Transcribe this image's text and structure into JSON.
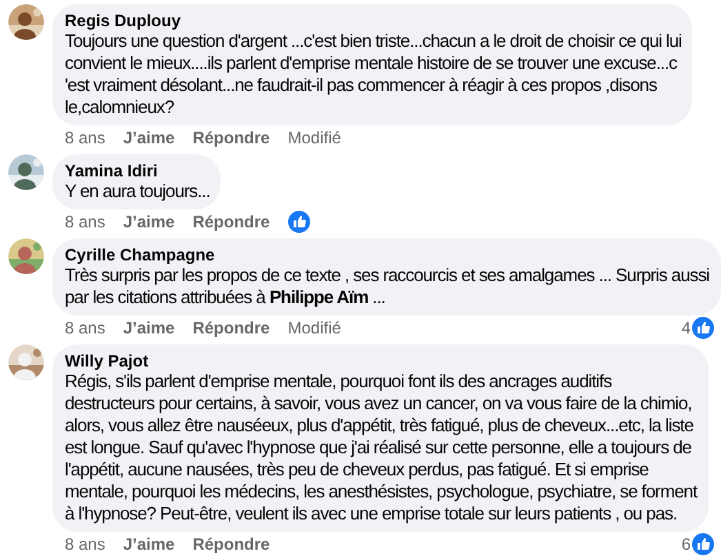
{
  "comments": [
    {
      "author": "Regis Duplouy",
      "lines": [
        "Toujours une question d'argent ...c'est bien triste...chacun a le droit de choisir ce qui lui",
        "convient le mieux....ils parlent d'emprise mentale histoire de se trouver une excuse...c",
        "'est vraiment désolant...ne faudrait-il pas commencer à réagir à ces propos ,disons",
        "le,calomnieux?"
      ],
      "time": "8 ans",
      "like": "J’aime",
      "reply": "Répondre",
      "edited": "Modifié"
    },
    {
      "author": "Yamina Idiri",
      "lines": [
        "Y en aura toujours..."
      ],
      "time": "8 ans",
      "like": "J’aime",
      "reply": "Répondre",
      "reaction": {
        "kind": "inline"
      }
    },
    {
      "author": "Cyrille Champagne",
      "lines": [
        "Très surpris par les propos de ce texte , ses raccourcis et ses amalgames ... Surpris aussi",
        "par les citations attribuées à **Philippe Aïm** ..."
      ],
      "time": "8 ans",
      "like": "J’aime",
      "reply": "Répondre",
      "edited": "Modifié",
      "reaction": {
        "kind": "counter",
        "count": "4"
      }
    },
    {
      "author": "Willy Pajot",
      "lines": [
        "Régis, s'ils parlent d'emprise mentale, pourquoi font ils des ancrages auditifs",
        "destructeurs pour certains, à savoir, vous avez un cancer, on va vous faire de la chimio,",
        "alors, vous allez être nauséeux, plus d'appétit, très fatigué, plus de cheveux...etc, la liste",
        "est longue. Sauf qu'avec l'hypnose que j'ai réalisé sur cette personne, elle a toujours de",
        "l'appétit, aucune nausées, très peu de cheveux perdus, pas fatigué. Et si emprise",
        "mentale, pourquoi les médecins, les anesthésistes, psychologue, psychiatre, se forment",
        "à l'hypnose? Peut-être, veulent ils avec une emprise totale sur leurs patients , ou pas."
      ],
      "time": "8 ans",
      "like": "J’aime",
      "reply": "Répondre",
      "reaction": {
        "kind": "counter",
        "count": "6"
      }
    }
  ]
}
